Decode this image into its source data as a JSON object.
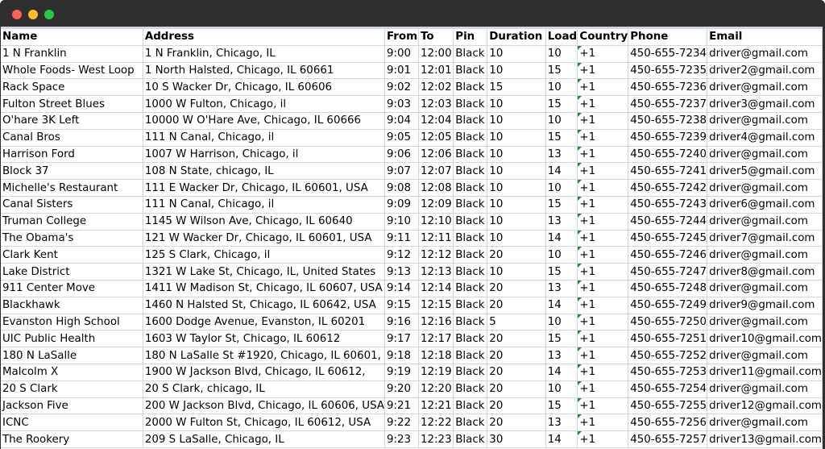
{
  "window": {
    "controls": [
      "close",
      "minimize",
      "zoom"
    ],
    "colors": {
      "close": "#fe5f57",
      "minimize": "#febc2e",
      "zoom": "#28c840",
      "titlebar": "#2f2f2f",
      "gridline": "#d0d7e5",
      "comment_indicator": "#1a8a2a"
    }
  },
  "sheet": {
    "columns": [
      "Name",
      "Address",
      "From",
      "To",
      "Pin",
      "Duration",
      "Load",
      "Country",
      "Phone",
      "Email"
    ],
    "rows": [
      [
        "1 N Franklin",
        "1 N Franklin, Chicago, IL",
        "9:00",
        "12:00",
        "Black",
        "10",
        "10",
        "+1",
        "450-655-7234",
        "driver@gmail.com"
      ],
      [
        "Whole Foods- West Loop",
        "1 North Halsted, Chicago, IL 60661",
        "9:01",
        "12:01",
        "Black",
        "10",
        "15",
        "+1",
        "450-655-7235",
        "driver2@gmail.com"
      ],
      [
        "Rack Space",
        "10 S Wacker Dr, Chicago, IL 60606",
        "9:02",
        "12:02",
        "Black",
        "15",
        "10",
        "+1",
        "450-655-7236",
        "driver@gmail.com"
      ],
      [
        "Fulton Street Blues",
        "1000 W Fulton, Chicago, il",
        "9:03",
        "12:03",
        "Black",
        "10",
        "15",
        "+1",
        "450-655-7237",
        "driver3@gmail.com"
      ],
      [
        "O'hare 3K Left",
        "10000 W O'Hare Ave, Chicago, IL 60666",
        "9:04",
        "12:04",
        "Black",
        "10",
        "10",
        "+1",
        "450-655-7238",
        "driver@gmail.com"
      ],
      [
        "Canal Bros",
        "111 N Canal, Chicago, il",
        "9:05",
        "12:05",
        "Black",
        "10",
        "15",
        "+1",
        "450-655-7239",
        "driver4@gmail.com"
      ],
      [
        "Harrison Ford",
        "1007 W Harrison, Chicago, il",
        "9:06",
        "12:06",
        "Black",
        "10",
        "13",
        "+1",
        "450-655-7240",
        "driver@gmail.com"
      ],
      [
        "Block 37",
        "108 N State, chicago, IL",
        "9:07",
        "12:07",
        "Black",
        "10",
        "14",
        "+1",
        "450-655-7241",
        "driver5@gmail.com"
      ],
      [
        "Michelle's Restaurant",
        "111 E Wacker Dr, Chicago, IL 60601, USA",
        "9:08",
        "12:08",
        "Black",
        "10",
        "10",
        "+1",
        "450-655-7242",
        "driver@gmail.com"
      ],
      [
        "Canal Sisters",
        "111 N Canal, Chicago, il",
        "9:09",
        "12:09",
        "Black",
        "10",
        "15",
        "+1",
        "450-655-7243",
        "driver6@gmail.com"
      ],
      [
        "Truman College",
        "1145 W Wilson Ave, Chicago, IL 60640",
        "9:10",
        "12:10",
        "Black",
        "10",
        "13",
        "+1",
        "450-655-7244",
        "driver@gmail.com"
      ],
      [
        "The Obama's",
        "121 W Wacker Dr, Chicago, IL 60601, USA",
        "9:11",
        "12:11",
        "Black",
        "10",
        "14",
        "+1",
        "450-655-7245",
        "driver7@gmail.com"
      ],
      [
        "Clark Kent",
        "125 S Clark, Chicago, il",
        "9:12",
        "12:12",
        "Black",
        "20",
        "10",
        "+1",
        "450-655-7246",
        "driver@gmail.com"
      ],
      [
        "Lake District",
        "1321 W Lake St, Chicago, IL, United States",
        "9:13",
        "12:13",
        "Black",
        "10",
        "15",
        "+1",
        "450-655-7247",
        "driver8@gmail.com"
      ],
      [
        "911 Center Move",
        "1411 W Madison St, Chicago, IL 60607, USA",
        "9:14",
        "12:14",
        "Black",
        "20",
        "13",
        "+1",
        "450-655-7248",
        "driver@gmail.com"
      ],
      [
        "Blackhawk",
        "1460 N Halsted St, Chicago, IL 60642, USA",
        "9:15",
        "12:15",
        "Black",
        "20",
        "14",
        "+1",
        "450-655-7249",
        "driver9@gmail.com"
      ],
      [
        "Evanston High School",
        "1600 Dodge Avenue, Evanston, IL 60201",
        "9:16",
        "12:16",
        "Black",
        "5",
        "10",
        "+1",
        "450-655-7250",
        "driver@gmail.com"
      ],
      [
        "UIC Public Health",
        "1603 W Taylor St, Chicago, IL 60612",
        "9:17",
        "12:17",
        "Black",
        "20",
        "15",
        "+1",
        "450-655-7251",
        "driver10@gmail.com"
      ],
      [
        "180 N LaSalle",
        "180 N LaSalle St #1920, Chicago, IL 60601,",
        "9:18",
        "12:18",
        "Black",
        "20",
        "13",
        "+1",
        "450-655-7252",
        "driver@gmail.com"
      ],
      [
        "Malcolm X",
        "1900 W Jackson Blvd, Chicago, IL 60612,",
        "9:19",
        "12:19",
        "Black",
        "20",
        "14",
        "+1",
        "450-655-7253",
        "driver11@gmail.com"
      ],
      [
        "20 S Clark",
        "20 S Clark, chicago, IL",
        "9:20",
        "12:20",
        "Black",
        "20",
        "10",
        "+1",
        "450-655-7254",
        "driver@gmail.com"
      ],
      [
        "Jackson Five",
        "200 W Jackson Blvd, Chicago, IL 60606, USA",
        "9:21",
        "12:21",
        "Black",
        "20",
        "15",
        "+1",
        "450-655-7255",
        "driver12@gmail.com"
      ],
      [
        "ICNC",
        "2000 W Fulton St, Chicago, IL 60612, USA",
        "9:22",
        "12:22",
        "Black",
        "20",
        "13",
        "+1",
        "450-655-7256",
        "driver@gmail.com"
      ],
      [
        "The Rookery",
        "209 S LaSalle, Chicago, IL",
        "9:23",
        "12:23",
        "Black",
        "30",
        "14",
        "+1",
        "450-655-7257",
        "driver13@gmail.com"
      ]
    ]
  }
}
